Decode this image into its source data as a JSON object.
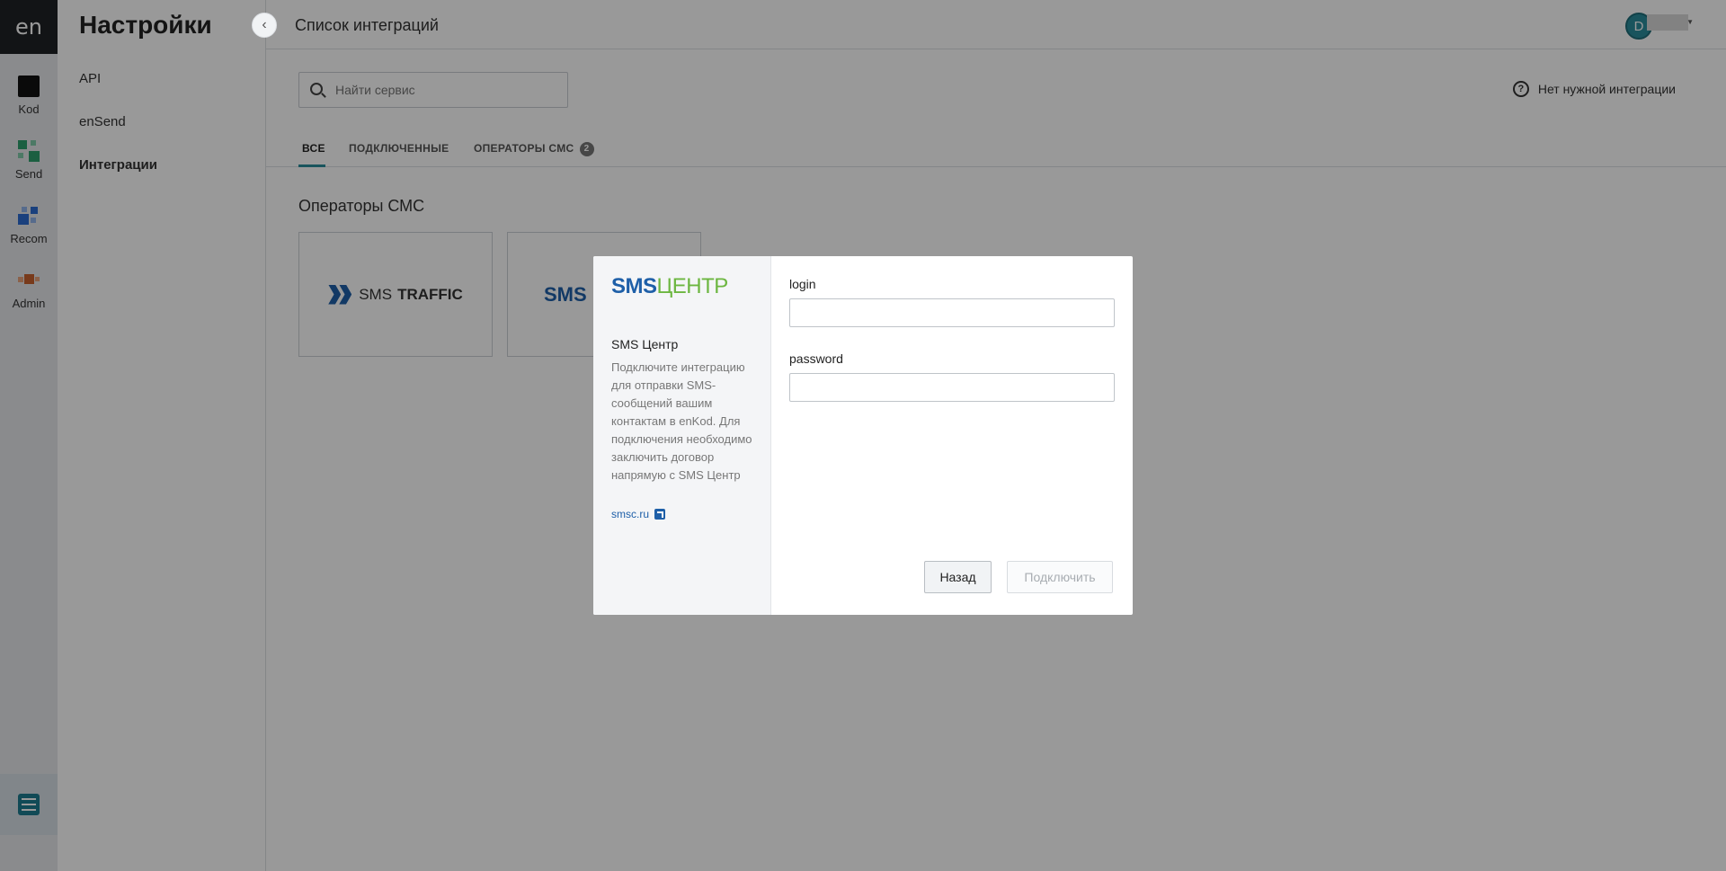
{
  "rail": {
    "logo": "en",
    "items": [
      {
        "label": "Kod",
        "icon": "kod-icon"
      },
      {
        "label": "Send",
        "icon": "send-icon"
      },
      {
        "label": "Recom",
        "icon": "recom-icon"
      },
      {
        "label": "Admin",
        "icon": "admin-icon"
      }
    ],
    "bottom_icon": "settings-sliders-icon"
  },
  "sidebar": {
    "title": "Настройки",
    "items": [
      {
        "label": "API"
      },
      {
        "label": "enSend"
      },
      {
        "label": "Интеграции",
        "active": true
      }
    ]
  },
  "header": {
    "title": "Список интеграций",
    "user_initial": "D"
  },
  "search": {
    "placeholder": "Найти сервис"
  },
  "no_integration": {
    "label": "Нет нужной интеграции"
  },
  "tabs": [
    {
      "label": "ВСЕ",
      "active": true
    },
    {
      "label": "ПОДКЛЮЧЕННЫЕ"
    },
    {
      "label": "ОПЕРАТОРЫ СМС",
      "badge": "2"
    }
  ],
  "section": {
    "title": "Операторы СМС"
  },
  "cards": [
    {
      "logo_text_light": "SMS",
      "logo_text_bold": "TRAFFIC"
    },
    {
      "logo_text": "SMS"
    }
  ],
  "modal": {
    "logo_sms": "SMS",
    "logo_centr": "ЦЕНТР",
    "name": "SMS Центр",
    "description": "Подключите интеграцию для отправки SMS-сообщений вашим контактам в enKod. Для подключения необходимо заключить договор напрямую с SMS Центр",
    "link": "smsc.ru",
    "fields": [
      {
        "label": "login",
        "value": ""
      },
      {
        "label": "password",
        "value": ""
      }
    ],
    "back_label": "Назад",
    "connect_label": "Подключить"
  },
  "colors": {
    "accent": "#2a8c9c",
    "sms_blue": "#1e5fa8",
    "centr_green": "#6cb640"
  }
}
